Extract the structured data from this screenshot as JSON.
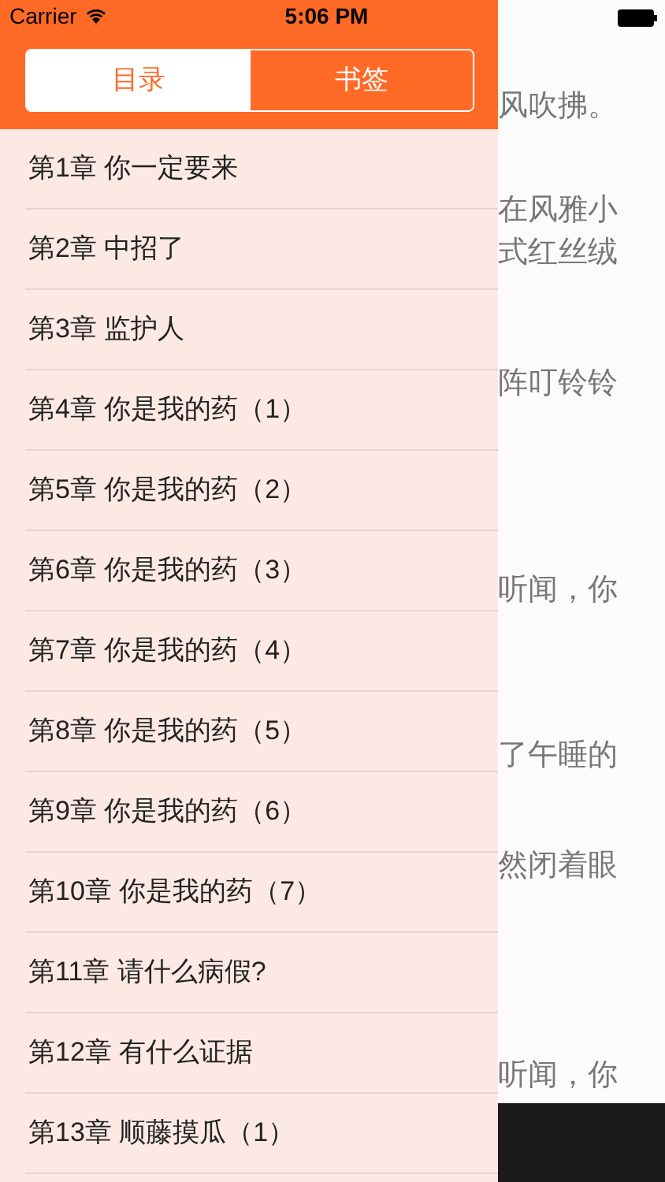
{
  "status_bar": {
    "carrier": "Carrier",
    "time": "5:06 PM"
  },
  "tabs": [
    {
      "label": "目录",
      "selected": true
    },
    {
      "label": "书签",
      "selected": false
    }
  ],
  "chapters": [
    "第1章 你一定要来",
    "第2章 中招了",
    "第3章 监护人",
    "第4章 你是我的药（1）",
    "第5章 你是我的药（2）",
    "第6章 你是我的药（3）",
    "第7章 你是我的药（4）",
    "第8章 你是我的药（5）",
    "第9章 你是我的药（6）",
    "第10章 你是我的药（7）",
    "第11章 请什么病假?",
    "第12章 有什么证据",
    "第13章 顺藤摸瓜（1）"
  ],
  "reader_lines": [
    "风吹拂。",
    "在风雅小",
    "式红丝绒",
    "阵叮铃铃",
    "听闻，你",
    "了午睡的",
    "然闭着眼",
    "听闻，你"
  ]
}
